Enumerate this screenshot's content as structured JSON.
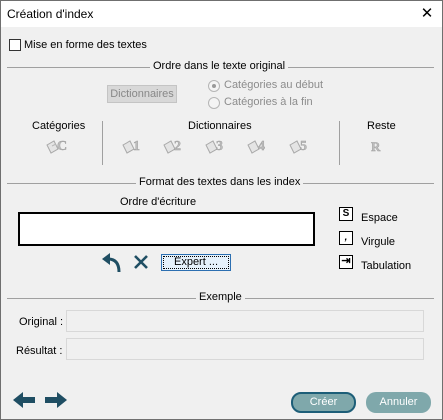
{
  "window": {
    "title": "Création d'index",
    "close_symbol": "✕"
  },
  "format_checkbox": {
    "label": "Mise en forme des textes",
    "checked": false
  },
  "original_order": {
    "title": "Ordre dans le texte original",
    "dictionaries_button": "Dictionnaires",
    "radio_options": [
      {
        "label": "Catégories au début",
        "selected": true
      },
      {
        "label": "Catégories à la fin",
        "selected": false
      }
    ],
    "categories_label": "Catégories",
    "dictionaries_label": "Dictionnaires",
    "rest_label": "Reste",
    "category_icon_letter": "C",
    "dictionary_numbers": [
      "1",
      "2",
      "3",
      "4",
      "5"
    ],
    "rest_icon_letter": "R"
  },
  "index_format": {
    "title": "Format des textes dans les index",
    "writing_order_label": "Ordre d'écriture",
    "expert_button": "Expert ...",
    "separators": [
      {
        "symbol": "S",
        "label": "Espace"
      },
      {
        "symbol": ",",
        "label": "Virgule"
      },
      {
        "symbol": "⇥",
        "label": "Tabulation"
      }
    ]
  },
  "example": {
    "title": "Exemple",
    "original_label": "Original :",
    "original_value": "",
    "result_label": "Résultat :",
    "result_value": ""
  },
  "footer": {
    "create_button": "Créer",
    "cancel_button": "Annuler"
  },
  "colors": {
    "pill_button": "#7fa8ab",
    "pill_border": "#1d5e78",
    "nav_arrow": "#1f4e63"
  }
}
